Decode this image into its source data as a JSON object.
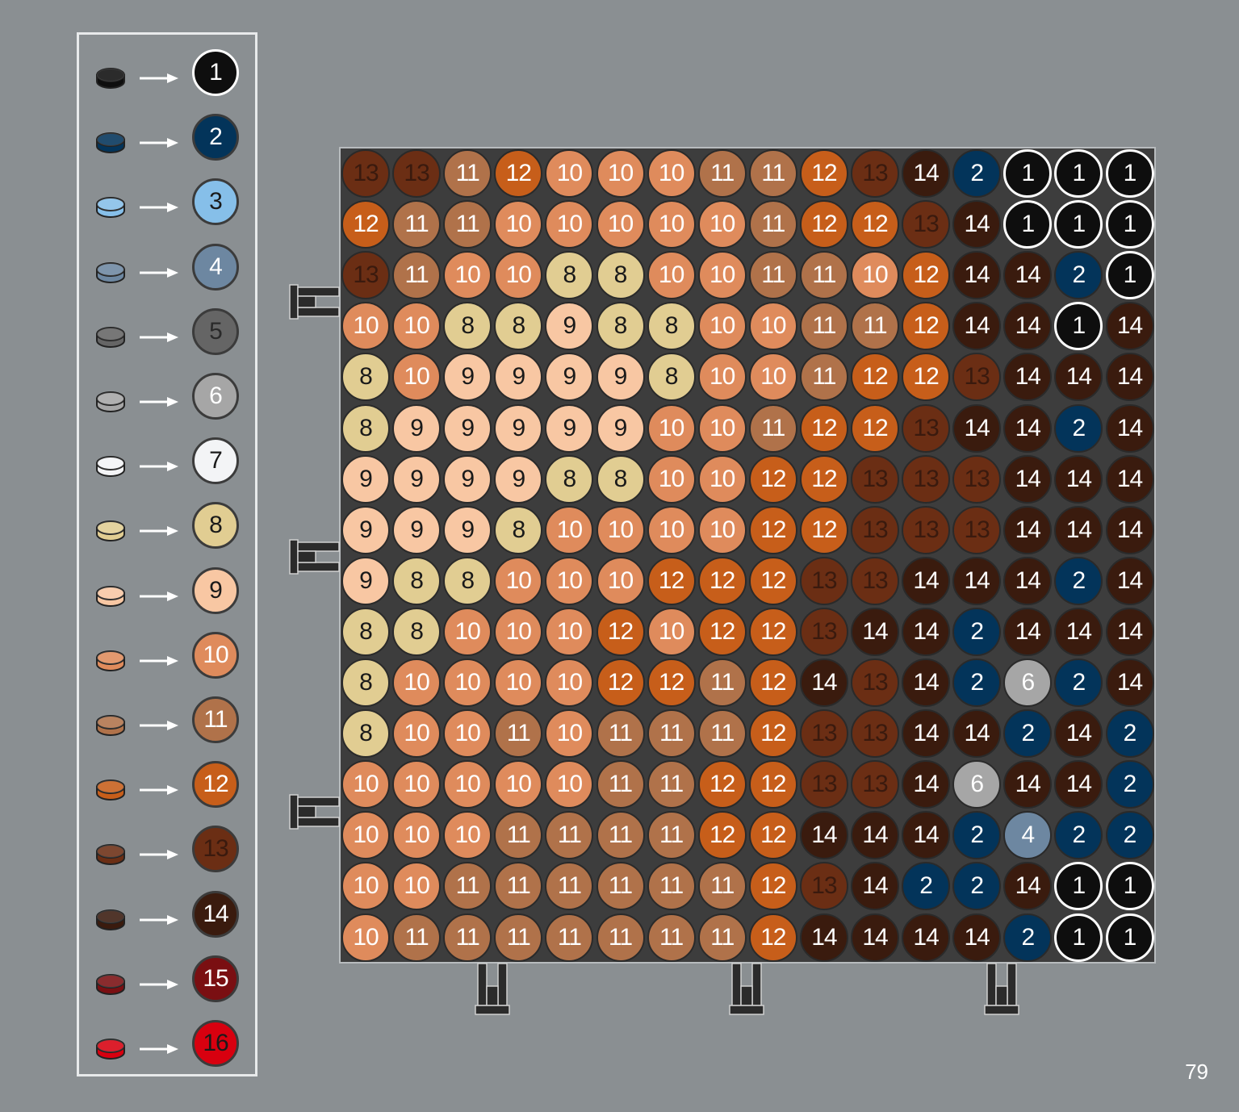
{
  "page_number": "79",
  "palette": [
    {
      "id": "1",
      "color": "#0e0e0e",
      "text": "#ffffff"
    },
    {
      "id": "2",
      "color": "#03345a",
      "text": "#ffffff"
    },
    {
      "id": "3",
      "color": "#86bfe9",
      "text": "#1a1a1a"
    },
    {
      "id": "4",
      "color": "#6d87a1",
      "text": "#ffffff"
    },
    {
      "id": "5",
      "color": "#656565",
      "text": "#2a2a2a"
    },
    {
      "id": "6",
      "color": "#a6a6a6",
      "text": "#ffffff"
    },
    {
      "id": "7",
      "color": "#f3f4f6",
      "text": "#1a1a1a"
    },
    {
      "id": "8",
      "color": "#e1cd92",
      "text": "#1a1a1a"
    },
    {
      "id": "9",
      "color": "#f8c7a3",
      "text": "#1a1a1a"
    },
    {
      "id": "10",
      "color": "#df8b5c",
      "text": "#ffffff"
    },
    {
      "id": "11",
      "color": "#b0724a",
      "text": "#ffffff"
    },
    {
      "id": "12",
      "color": "#c75e1a",
      "text": "#ffffff"
    },
    {
      "id": "13",
      "color": "#6b2e14",
      "text": "#3a1a0e"
    },
    {
      "id": "14",
      "color": "#3a1b0e",
      "text": "#ffffff"
    },
    {
      "id": "15",
      "color": "#7a0f12",
      "text": "#ffffff"
    },
    {
      "id": "16",
      "color": "#d8000f",
      "text": "#1a1a1a"
    }
  ],
  "grid": [
    [
      "13",
      "13",
      "11",
      "12",
      "10",
      "10",
      "10",
      "11",
      "11",
      "12",
      "13",
      "14",
      "2",
      "1",
      "1",
      "1"
    ],
    [
      "12",
      "11",
      "11",
      "10",
      "10",
      "10",
      "10",
      "10",
      "11",
      "12",
      "12",
      "13",
      "14",
      "1",
      "1",
      "1"
    ],
    [
      "13",
      "11",
      "10",
      "10",
      "8",
      "8",
      "10",
      "10",
      "11",
      "11",
      "10",
      "12",
      "14",
      "14",
      "2",
      "1"
    ],
    [
      "10",
      "10",
      "8",
      "8",
      "9",
      "8",
      "8",
      "10",
      "10",
      "11",
      "11",
      "12",
      "14",
      "14",
      "1",
      "14"
    ],
    [
      "8",
      "10",
      "9",
      "9",
      "9",
      "9",
      "8",
      "10",
      "10",
      "11",
      "12",
      "12",
      "13",
      "14",
      "14",
      "14"
    ],
    [
      "8",
      "9",
      "9",
      "9",
      "9",
      "9",
      "10",
      "10",
      "11",
      "12",
      "12",
      "13",
      "14",
      "14",
      "2",
      "14"
    ],
    [
      "9",
      "9",
      "9",
      "9",
      "8",
      "8",
      "10",
      "10",
      "12",
      "12",
      "13",
      "13",
      "13",
      "14",
      "14",
      "14"
    ],
    [
      "9",
      "9",
      "9",
      "8",
      "10",
      "10",
      "10",
      "10",
      "12",
      "12",
      "13",
      "13",
      "13",
      "14",
      "14",
      "14"
    ],
    [
      "9",
      "8",
      "8",
      "10",
      "10",
      "10",
      "12",
      "12",
      "12",
      "13",
      "13",
      "14",
      "14",
      "14",
      "2",
      "14"
    ],
    [
      "8",
      "8",
      "10",
      "10",
      "10",
      "12",
      "10",
      "12",
      "12",
      "13",
      "14",
      "14",
      "2",
      "14",
      "14",
      "14"
    ],
    [
      "8",
      "10",
      "10",
      "10",
      "10",
      "12",
      "12",
      "11",
      "12",
      "14",
      "13",
      "14",
      "2",
      "6",
      "2",
      "14"
    ],
    [
      "8",
      "10",
      "10",
      "11",
      "10",
      "11",
      "11",
      "11",
      "12",
      "13",
      "13",
      "14",
      "14",
      "2",
      "14",
      "2"
    ],
    [
      "10",
      "10",
      "10",
      "10",
      "10",
      "11",
      "11",
      "12",
      "12",
      "13",
      "13",
      "14",
      "6",
      "14",
      "14",
      "2"
    ],
    [
      "10",
      "10",
      "10",
      "11",
      "11",
      "11",
      "11",
      "12",
      "12",
      "14",
      "14",
      "14",
      "2",
      "4",
      "2",
      "2"
    ],
    [
      "10",
      "10",
      "11",
      "11",
      "11",
      "11",
      "11",
      "11",
      "12",
      "13",
      "14",
      "2",
      "2",
      "14",
      "1",
      "1"
    ],
    [
      "10",
      "11",
      "11",
      "11",
      "11",
      "11",
      "11",
      "11",
      "12",
      "14",
      "14",
      "14",
      "14",
      "2",
      "1",
      "1"
    ]
  ]
}
